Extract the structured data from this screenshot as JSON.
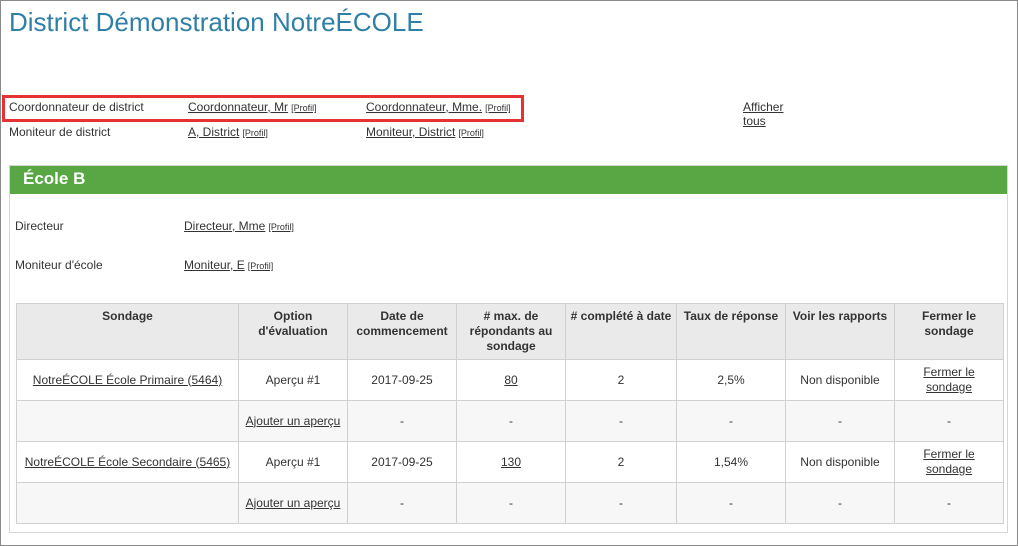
{
  "page_title": "District Démonstration NotreÉCOLE",
  "district": {
    "coordinator_label": "Coordonnateur de district",
    "coordinator_1": "Coordonnateur, Mr",
    "coordinator_2": "Coordonnateur, Mme.",
    "monitor_label": "Moniteur de district",
    "monitor_1": "A, District",
    "monitor_2": "Moniteur, District",
    "profile_label": "[Profil]",
    "show_all_line1": "Afficher",
    "show_all_line2": "tous"
  },
  "school": {
    "name": "École B",
    "director_label": "Directeur",
    "director_name": "Directeur, Mme",
    "monitor_label": "Moniteur d'école",
    "monitor_name": "Moniteur, E",
    "profile_label": "[Profil]"
  },
  "table": {
    "headers": [
      "Sondage",
      "Option d'évaluation",
      "Date de commencement",
      "# max. de répondants au sondage",
      "# complété à date",
      "Taux de réponse",
      "Voir les rapports",
      "Fermer le sondage"
    ],
    "rows": [
      {
        "survey": "NotreÉCOLE École Primaire (5464)",
        "option": "Aperçu #1",
        "date": "2017-09-25",
        "max": "80",
        "completed": "2",
        "rate": "2,5%",
        "reports": "Non disponible",
        "close": "Fermer le sondage"
      },
      {
        "survey": "",
        "option": "Ajouter un aperçu",
        "date": "-",
        "max": "-",
        "completed": "-",
        "rate": "-",
        "reports": "-",
        "close": "-"
      },
      {
        "survey": "NotreÉCOLE École Secondaire (5465)",
        "option": "Aperçu #1",
        "date": "2017-09-25",
        "max": "130",
        "completed": "2",
        "rate": "1,54%",
        "reports": "Non disponible",
        "close": "Fermer le sondage"
      },
      {
        "survey": "",
        "option": "Ajouter un aperçu",
        "date": "-",
        "max": "-",
        "completed": "-",
        "rate": "-",
        "reports": "-",
        "close": "-"
      }
    ]
  },
  "colors": {
    "title": "#2f7fa6",
    "school_header": "#58a744",
    "highlight_border": "#e53232",
    "date": "#7aa33a"
  }
}
